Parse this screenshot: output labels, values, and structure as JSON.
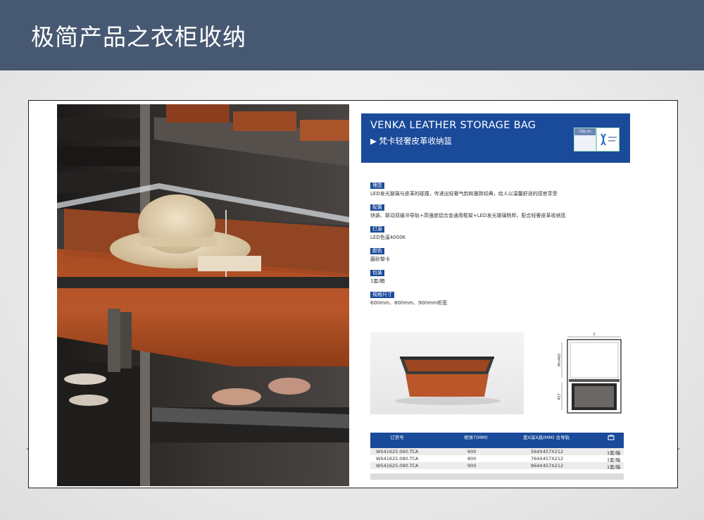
{
  "header": {
    "title": "极简产品之衣柜收纳"
  },
  "banner": {
    "title": "VENKA LEATHER STORAGE BAG",
    "subtitle": "▶ 梵卡轻奢皮革收纳篮",
    "badge_clip": "Clip on"
  },
  "specs": [
    {
      "label": "理念",
      "text": "LED发光玻璃与皮革的碰撞，传递出轻奢气韵和雅致经典，给人以温馨舒适的感官享受"
    },
    {
      "label": "配置",
      "text": "快装、联动双缓冲导轨+高强度铝合金通用框架+LED发光玻璃侧邦，配合轻奢皮革收纳篮"
    },
    {
      "label": "灯源",
      "text": "LED色温4000K"
    },
    {
      "label": "颜色",
      "text": "磨砂黎卡"
    },
    {
      "label": "包装",
      "text": "1套/箱"
    },
    {
      "label": "规格尺寸",
      "text": "600mm、800mm、900mm柜宽"
    }
  ],
  "diagram": {
    "top_label": "T",
    "side_label_top": "Min465",
    "side_label_bottom": "457"
  },
  "table": {
    "headers": [
      "订货号",
      "柜体T(MM)",
      "宽X深X高(MM) 含导轨",
      ""
    ],
    "rows": [
      {
        "code": "WS41625.060.TCA",
        "t": "600",
        "size": "564X457X212",
        "qty": "1套/箱"
      },
      {
        "code": "WS41625.080.TCA",
        "t": "800",
        "size": "764X457X212",
        "qty": "1套/箱"
      },
      {
        "code": "WS41625.090.TCA",
        "t": "900",
        "size": "864X457X212",
        "qty": "1套/箱"
      }
    ]
  },
  "colors": {
    "header_bg": "#475872",
    "brand_blue": "#1a4a9a",
    "leather": "#b9572a"
  }
}
